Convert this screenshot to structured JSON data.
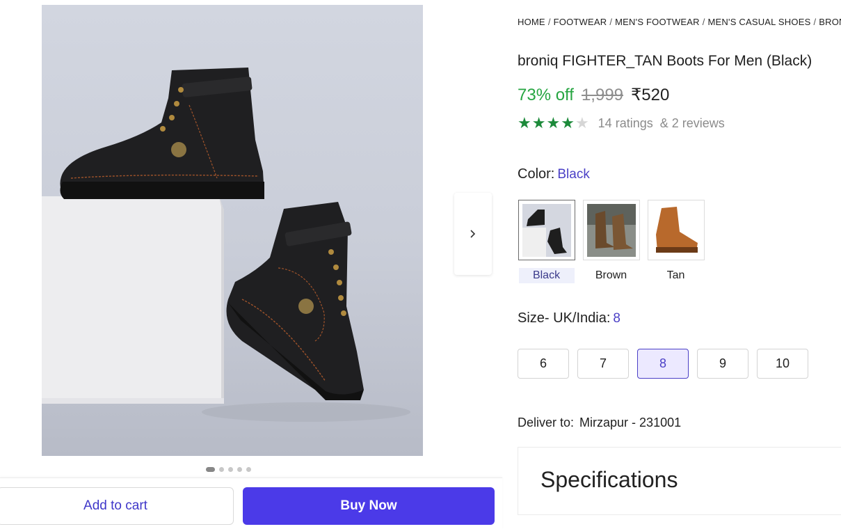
{
  "gallery": {
    "image_count": 5,
    "active_index": 0
  },
  "breadcrumb": [
    "HOME",
    "FOOTWEAR",
    "MEN'S FOOTWEAR",
    "MEN'S CASUAL SHOES",
    "BRON"
  ],
  "product": {
    "title": "broniq FIGHTER_TAN Boots For Men (Black)",
    "discount": "73% off",
    "mrp": "1,999",
    "price": "₹520",
    "rating_stars": 4,
    "ratings_text": "14 ratings",
    "reviews_text": "& 2 reviews"
  },
  "color": {
    "label": "Color:",
    "selected": "Black",
    "options": [
      "Black",
      "Brown",
      "Tan"
    ]
  },
  "size": {
    "label": "Size- UK/India:",
    "selected": "8",
    "options": [
      "6",
      "7",
      "8",
      "9",
      "10"
    ]
  },
  "delivery": {
    "label": "Deliver to:",
    "location": "Mirzapur - 231001"
  },
  "specifications": {
    "title": "Specifications"
  },
  "actions": {
    "add_to_cart": "Add to cart",
    "buy_now": "Buy Now"
  },
  "colors": {
    "accent": "#4b3ae8",
    "discount_green": "#26a541",
    "star_green": "#1c8a3a"
  }
}
